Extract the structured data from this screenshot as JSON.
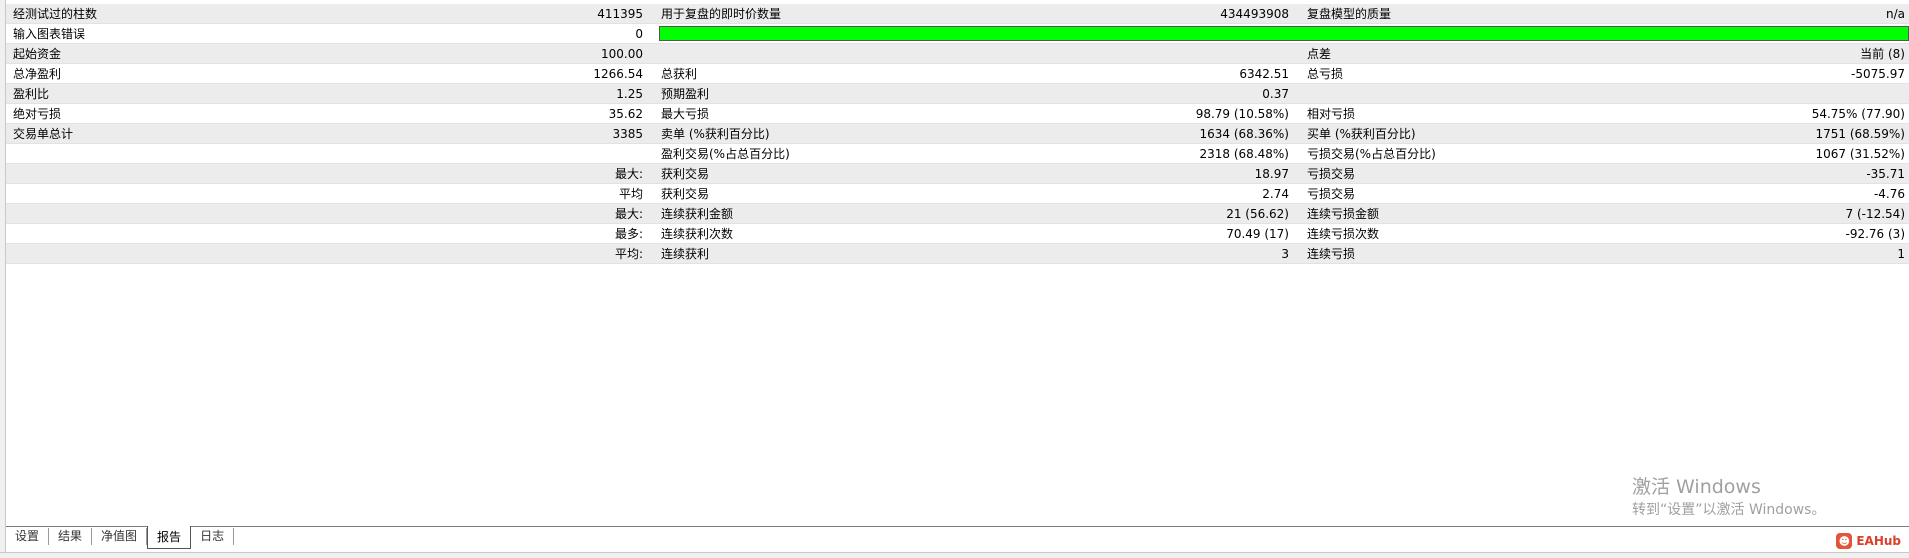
{
  "report": {
    "rows": [
      {
        "l1": "经测试过的柱数",
        "v1": "411395",
        "l2": "用于复盘的即时价数量",
        "v2": "434493908",
        "l3": "复盘模型的质量",
        "v3": "n/a"
      },
      {
        "l1": "输入图表错误",
        "v1": "0",
        "bar": true
      },
      {
        "l1": "起始资金",
        "v1": "100.00",
        "l2": "",
        "v2": "",
        "l3": "点差",
        "v3": "当前 (8)"
      },
      {
        "l1": "总净盈利",
        "v1": "1266.54",
        "l2": "总获利",
        "v2": "6342.51",
        "l3": "总亏损",
        "v3": "-5075.97"
      },
      {
        "l1": "盈利比",
        "v1": "1.25",
        "l2": "预期盈利",
        "v2": "0.37",
        "l3": "",
        "v3": ""
      },
      {
        "l1": "绝对亏损",
        "v1": "35.62",
        "l2": "最大亏损",
        "v2": "98.79 (10.58%)",
        "l3": "相对亏损",
        "v3": "54.75% (77.90)"
      },
      {
        "l1": "交易单总计",
        "v1": "3385",
        "l2": "卖单 (%获利百分比)",
        "v2": "1634 (68.36%)",
        "l3": "买单 (%获利百分比)",
        "v3": "1751 (68.59%)"
      },
      {
        "l1": "",
        "v1": "",
        "l2": "盈利交易(%占总百分比)",
        "v2": "2318 (68.48%)",
        "l3": "亏损交易(%占总百分比)",
        "v3": "1067 (31.52%)"
      },
      {
        "l1": "",
        "v1": "最大:",
        "l2": "获利交易",
        "v2": "18.97",
        "l3": "亏损交易",
        "v3": "-35.71"
      },
      {
        "l1": "",
        "v1": "平均",
        "l2": "获利交易",
        "v2": "2.74",
        "l3": "亏损交易",
        "v3": "-4.76"
      },
      {
        "l1": "",
        "v1": "最大:",
        "l2": "连续获利金额",
        "v2": "21 (56.62)",
        "l3": "连续亏损金额",
        "v3": "7 (-12.54)"
      },
      {
        "l1": "",
        "v1": "最多:",
        "l2": "连续获利次数",
        "v2": "70.49 (17)",
        "l3": "连续亏损次数",
        "v3": "-92.76 (3)"
      },
      {
        "l1": "",
        "v1": "平均:",
        "l2": "连续获利",
        "v2": "3",
        "l3": "连续亏损",
        "v3": "1"
      }
    ],
    "quality_bar_color": "#00ff00"
  },
  "watermark": {
    "title": "激活 Windows",
    "subtitle": "转到“设置”以激活 Windows。"
  },
  "tabs": [
    {
      "label": "设置",
      "active": false
    },
    {
      "label": "结果",
      "active": false
    },
    {
      "label": "净值图",
      "active": false
    },
    {
      "label": "报告",
      "active": true
    },
    {
      "label": "日志",
      "active": false
    }
  ],
  "brand": {
    "text": "EAHub",
    "icon": "eahub-logo-icon"
  }
}
